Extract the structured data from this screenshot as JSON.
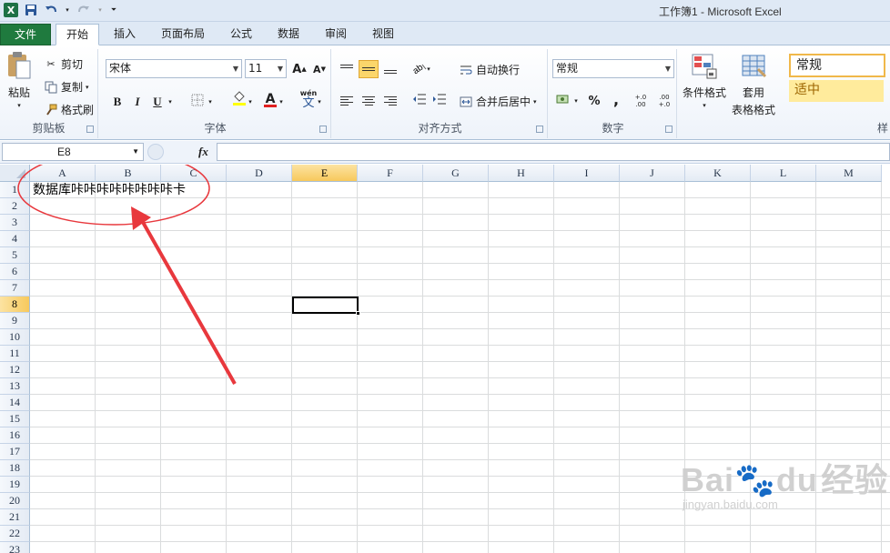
{
  "window": {
    "title": "工作簿1 - Microsoft Excel",
    "app_icon": "X"
  },
  "ribbon_tabs": [
    {
      "label": "文件"
    },
    {
      "label": "开始"
    },
    {
      "label": "插入"
    },
    {
      "label": "页面布局"
    },
    {
      "label": "公式"
    },
    {
      "label": "数据"
    },
    {
      "label": "审阅"
    },
    {
      "label": "视图"
    }
  ],
  "clipboard": {
    "paste": "粘贴",
    "cut": "剪切",
    "copy": "复制",
    "format_painter": "格式刷",
    "group_label": "剪贴板"
  },
  "font": {
    "name": "宋体",
    "size": "11",
    "bold": "B",
    "italic": "I",
    "underline": "U",
    "increase": "A",
    "decrease": "A",
    "fill_letter": "",
    "font_color_letter": "A",
    "phonetic": "wén",
    "phonetic_char": "文",
    "group_label": "字体"
  },
  "alignment": {
    "wrap_text": "自动换行",
    "merge_center": "合并后居中",
    "group_label": "对齐方式"
  },
  "number": {
    "format": "常规",
    "percent": "%",
    "comma": ",",
    "inc_decimal": "+.0 .00",
    "dec_decimal": ".00 +.0",
    "group_label": "数字"
  },
  "styles": {
    "conditional": "条件格式",
    "table_line1": "套用",
    "table_line2": "表格格式",
    "normal": "常规",
    "neutral": "适中",
    "group_label_partial": "样"
  },
  "formula_bar": {
    "name_box": "E8",
    "fx": "fx",
    "content": ""
  },
  "grid": {
    "columns": [
      "A",
      "B",
      "C",
      "D",
      "E",
      "F",
      "G",
      "H",
      "I",
      "J",
      "K",
      "L",
      "M"
    ],
    "rows": [
      "1",
      "2",
      "3",
      "4",
      "5",
      "6",
      "7",
      "8",
      "9",
      "10",
      "11",
      "12",
      "13",
      "14",
      "15",
      "16",
      "17",
      "18",
      "19",
      "20",
      "21",
      "22",
      "23"
    ],
    "selected_column": "E",
    "selected_row": "8",
    "cell_A1": "数据库咔咔咔咔咔咔咔咔卡"
  },
  "colors": {
    "annotation_red": "#e8383d",
    "file_tab_green": "#1f7a3e",
    "neutral_style_bg": "#ffeb9c",
    "neutral_style_text": "#9c6500"
  },
  "watermark": {
    "brand": "Bai",
    "brand_end": "du",
    "cn": "经验",
    "url": "jingyan.baidu.com"
  }
}
